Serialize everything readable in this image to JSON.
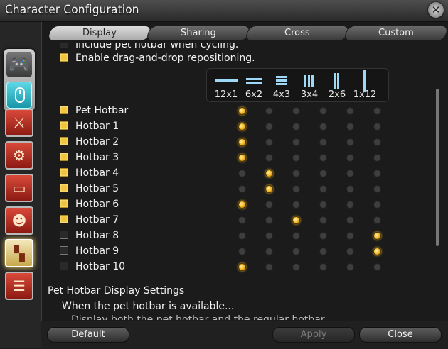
{
  "window": {
    "title": "Character Configuration"
  },
  "tabs": [
    {
      "label": "Display",
      "active": true
    },
    {
      "label": "Sharing",
      "active": false
    },
    {
      "label": "Cross",
      "active": false
    },
    {
      "label": "Custom",
      "active": false
    }
  ],
  "options": {
    "truncated_label": "Include pet hotbar when cycling.",
    "truncated_checked": false,
    "drag_drop_label": "Enable drag-and-drop repositioning.",
    "drag_drop_checked": true
  },
  "layouts": [
    "12x1",
    "6x2",
    "4x3",
    "3x4",
    "2x6",
    "1x12"
  ],
  "hotbars": [
    {
      "label": "Pet Hotbar",
      "enabled": true,
      "layout": 0
    },
    {
      "label": "Hotbar 1",
      "enabled": true,
      "layout": 0
    },
    {
      "label": "Hotbar 2",
      "enabled": true,
      "layout": 0
    },
    {
      "label": "Hotbar 3",
      "enabled": true,
      "layout": 0
    },
    {
      "label": "Hotbar 4",
      "enabled": true,
      "layout": 1
    },
    {
      "label": "Hotbar 5",
      "enabled": true,
      "layout": 1
    },
    {
      "label": "Hotbar 6",
      "enabled": true,
      "layout": 0
    },
    {
      "label": "Hotbar 7",
      "enabled": true,
      "layout": 2
    },
    {
      "label": "Hotbar 8",
      "enabled": false,
      "layout": 5
    },
    {
      "label": "Hotbar 9",
      "enabled": false,
      "layout": 5
    },
    {
      "label": "Hotbar 10",
      "enabled": false,
      "layout": 0
    }
  ],
  "pet_section": {
    "title": "Pet Hotbar Display Settings",
    "subtitle": "When the pet hotbar is available...",
    "truncated_text": "Display both the pet hotbar and the regular hotbar."
  },
  "buttons": {
    "default": "Default",
    "apply": "Apply",
    "close": "Close"
  },
  "icons": {
    "close": "close-icon",
    "gamepad": "gamepad-icon",
    "mouse": "mouse-icon",
    "categories": [
      "crossed-swords-icon",
      "gear-bag-icon",
      "id-card-icon",
      "character-icon",
      "hotbar-grid-icon",
      "chat-bubble-icon"
    ]
  },
  "colors": {
    "accent": "#f2c43a",
    "active_tab": "#c9c9c9"
  }
}
